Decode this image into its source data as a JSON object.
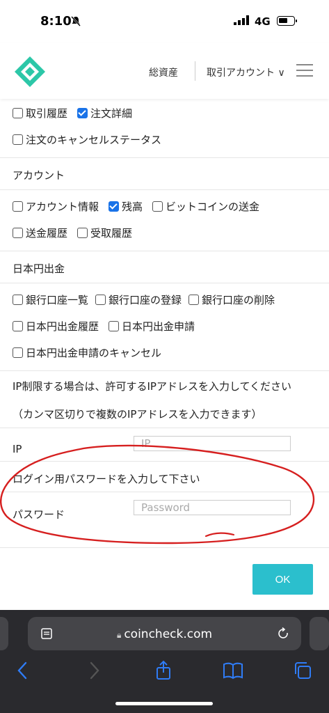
{
  "status_bar": {
    "time": "8:10",
    "network": "4G"
  },
  "header": {
    "total_assets": "総資産",
    "trading_account": "取引アカウント ∨"
  },
  "rows": {
    "r1": [
      {
        "label": "取引履歴",
        "checked": false
      },
      {
        "label": "注文詳細",
        "checked": true
      }
    ],
    "r2": [
      {
        "label": "注文のキャンセルステータス",
        "checked": false
      }
    ],
    "account_title": "アカウント",
    "r3": [
      {
        "label": "アカウント情報",
        "checked": false
      },
      {
        "label": "残高",
        "checked": true
      },
      {
        "label": "ビットコインの送金",
        "checked": false
      }
    ],
    "r4": [
      {
        "label": "送金履歴",
        "checked": false
      },
      {
        "label": "受取履歴",
        "checked": false
      }
    ],
    "jpy_title": "日本円出金",
    "r5": [
      {
        "label": "銀行口座一覧",
        "checked": false
      },
      {
        "label": "銀行口座の登録",
        "checked": false
      },
      {
        "label": "銀行口座の削除",
        "checked": false
      }
    ],
    "r6": [
      {
        "label": "日本円出金履歴",
        "checked": false
      },
      {
        "label": "日本円出金申請",
        "checked": false
      }
    ],
    "r7": [
      {
        "label": "日本円出金申請のキャンセル",
        "checked": false
      }
    ]
  },
  "ip_section": {
    "instruction": "IP制限する場合は、許可するIPアドレスを入力してください",
    "note": "（カンマ区切りで複数のIPアドレスを入力できます）",
    "label": "IP",
    "placeholder": "IP"
  },
  "password_section": {
    "instruction": "ログイン用パスワードを入力して下さい",
    "label": "パスワード",
    "placeholder": "Password"
  },
  "ok_label": "OK",
  "safari": {
    "url": "coincheck.com"
  },
  "colors": {
    "accent": "#2bbfcd",
    "checkbox": "#1a73e8",
    "annotation": "#d61f1f"
  }
}
